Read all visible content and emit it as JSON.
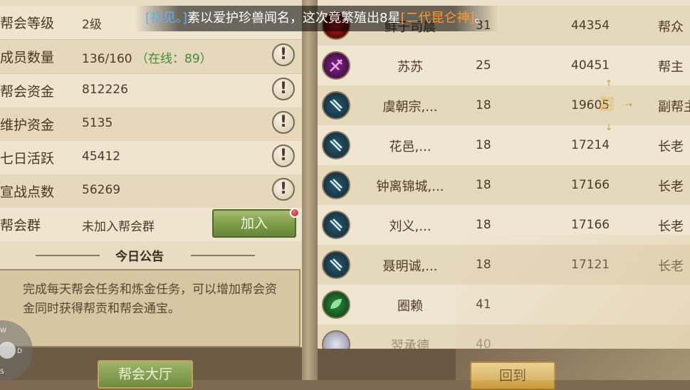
{
  "guild_info": {
    "rows": [
      {
        "label": "帮会等级",
        "value": "2级",
        "has_info": false
      },
      {
        "label": "成员数量",
        "value": "136/160",
        "extra": "（在线：89）",
        "has_info": true
      },
      {
        "label": "帮会资金",
        "value": "812226",
        "has_info": true
      },
      {
        "label": "维护资金",
        "value": "5135",
        "has_info": true
      },
      {
        "label": "七日活跃",
        "value": "45412",
        "has_info": true
      },
      {
        "label": "宣战点数",
        "value": "56269",
        "has_info": true
      },
      {
        "label": "帮会群",
        "value": "未加入帮会群",
        "has_info": false
      }
    ],
    "join_button": "加入",
    "notice_title": "今日公告",
    "notice_text": "完成每天帮会任务和炼金任务，可以增加帮会资金同时获得帮贡和帮会通宝。",
    "hall_button": "帮会大厅"
  },
  "joystick": {
    "w": "W",
    "d": "D",
    "s": "S"
  },
  "broadcast": {
    "prefix": "[初见。]",
    "text": "素以爱护珍兽闻名，这次竟繁殖出8星",
    "item": "[二代昆仑神]",
    "suffix": "。"
  },
  "swipe_hint": {
    "text": "滑动\n翻页",
    "arrow_right": "→",
    "arrow_up": "↑",
    "arrow_down": "↓"
  },
  "members": [
    {
      "name": "鲜于司晨",
      "level": "31",
      "power": "44354",
      "rank": "帮众",
      "avatar": "red-icon"
    },
    {
      "name": "苏苏",
      "level": "25",
      "power": "40451",
      "rank": "帮主",
      "avatar": "rogue-icon"
    },
    {
      "name": "虞朝宗,...",
      "level": "18",
      "power": "19605",
      "rank": "副帮主",
      "avatar": "sword-icon"
    },
    {
      "name": "花邑,...",
      "level": "18",
      "power": "17214",
      "rank": "长老",
      "avatar": "sword-icon"
    },
    {
      "name": "钟离锦城,...",
      "level": "18",
      "power": "17166",
      "rank": "长老",
      "avatar": "sword-icon"
    },
    {
      "name": "刘义,...",
      "level": "18",
      "power": "17166",
      "rank": "长老",
      "avatar": "sword-icon"
    },
    {
      "name": "聂明诚,...",
      "level": "18",
      "power": "17121",
      "rank": "长老",
      "avatar": "sword-icon"
    },
    {
      "name": "圈赖",
      "level": "41",
      "power": "",
      "rank": "",
      "avatar": "leaf-icon"
    },
    {
      "name": "翌承德",
      "level": "40",
      "power": "",
      "rank": "",
      "avatar": "light-icon"
    }
  ],
  "back_button": "回到"
}
